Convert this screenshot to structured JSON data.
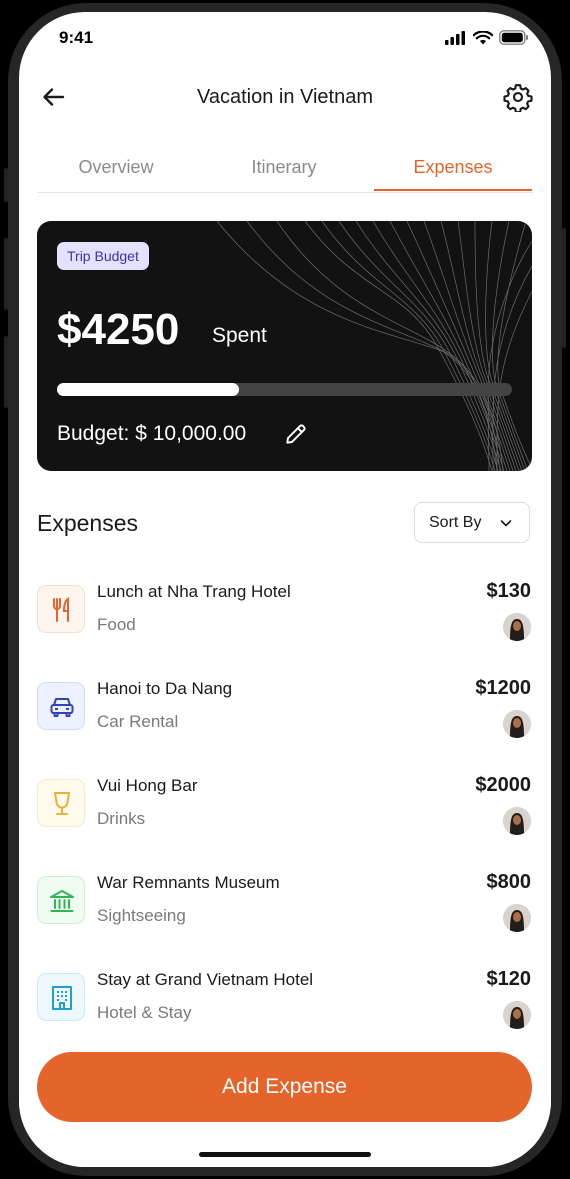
{
  "status_bar": {
    "time": "9:41"
  },
  "header": {
    "title": "Vacation in Vietnam",
    "back_icon": "arrow-left-icon",
    "settings_icon": "gear-icon"
  },
  "tabs": [
    {
      "label": "Overview",
      "active": false
    },
    {
      "label": "Itinerary",
      "active": false
    },
    {
      "label": "Expenses",
      "active": true
    }
  ],
  "budget_card": {
    "badge": "Trip Budget",
    "amount": "$4250",
    "amount_suffix": "Spent",
    "progress": 0.4,
    "budget_label": "Budget: $ 10,000.00"
  },
  "expenses_section": {
    "title": "Expenses",
    "sort_label": "Sort By"
  },
  "expenses": [
    {
      "title": "Lunch at Nha Trang Hotel",
      "category": "Food",
      "amount": "$130",
      "icon": "utensils-icon"
    },
    {
      "title": "Hanoi to Da Nang",
      "category": "Car Rental",
      "amount": "$1200",
      "icon": "car-icon"
    },
    {
      "title": "Vui Hong Bar",
      "category": "Drinks",
      "amount": "$2000",
      "icon": "wine-glass-icon"
    },
    {
      "title": "War Remnants Museum",
      "category": "Sightseeing",
      "amount": "$800",
      "icon": "museum-icon"
    },
    {
      "title": "Stay at Grand Vietnam Hotel",
      "category": "Hotel & Stay",
      "amount": "$120",
      "icon": "hotel-icon"
    }
  ],
  "primary_action": {
    "label": "Add Expense"
  },
  "colors": {
    "accent": "#e5642b",
    "card_bg": "#121212",
    "badge_bg": "#e2e1ff",
    "badge_text": "#3c34a8"
  }
}
